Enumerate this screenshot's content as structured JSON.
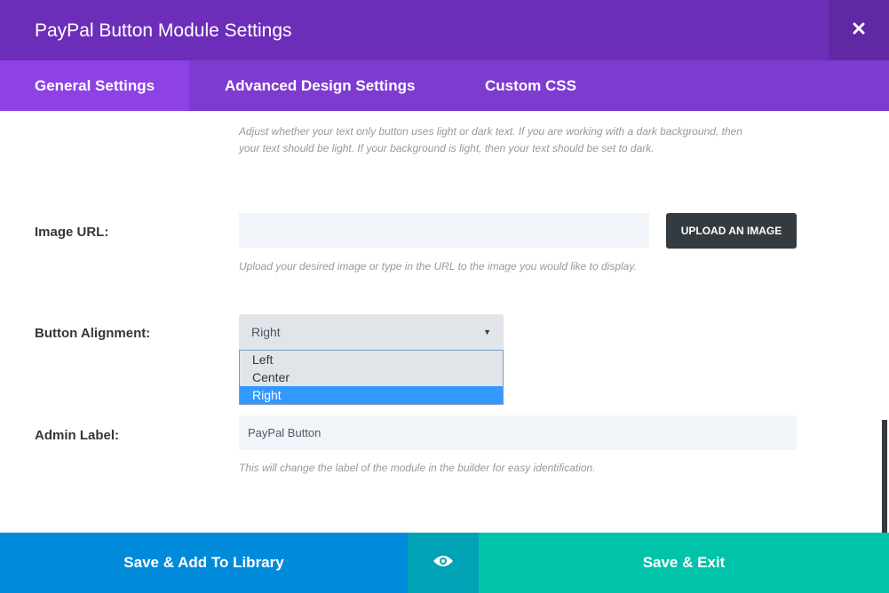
{
  "modal": {
    "title": "PayPal Button Module Settings",
    "close_icon": "close-icon"
  },
  "tabs": [
    {
      "label": "General Settings",
      "active": true
    },
    {
      "label": "Advanced Design Settings",
      "active": false
    },
    {
      "label": "Custom CSS",
      "active": false
    }
  ],
  "text_color": {
    "description": "Adjust whether your text only button uses light or dark text. If you are working with a dark background, then your text should be light. If your background is light, then your text should be set to dark."
  },
  "image_url": {
    "label": "Image URL:",
    "value": "",
    "button_label": "UPLOAD AN IMAGE",
    "description": "Upload your desired image or type in the URL to the image you would like to display."
  },
  "button_alignment": {
    "label": "Button Alignment:",
    "selected": "Right",
    "options": [
      "Left",
      "Center",
      "Right"
    ]
  },
  "admin_label": {
    "label": "Admin Label:",
    "value": "PayPal Button",
    "description": "This will change the label of the module in the builder for easy identification."
  },
  "footer": {
    "save_library_label": "Save & Add To Library",
    "preview_icon": "eye-icon",
    "save_exit_label": "Save & Exit"
  },
  "colors": {
    "header": "#6c2eb9",
    "tabs": "#7e3bd0",
    "active_tab": "#8e42e6",
    "save_library": "#008bda",
    "preview": "#00a3b5",
    "save_exit": "#00c3aa"
  }
}
